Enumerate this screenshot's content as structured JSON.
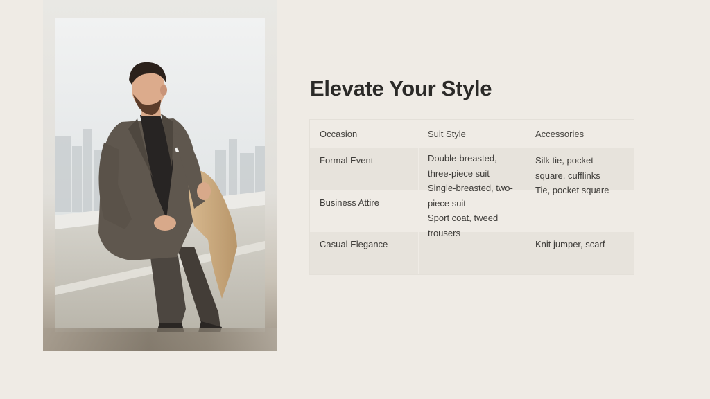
{
  "slide": {
    "title": "Elevate Your Style"
  },
  "photo": {
    "description_icon": "photo-man-in-tweed-suit"
  },
  "table": {
    "headers": [
      "Occasion",
      "Suit Style",
      "Accessories"
    ],
    "rows": [
      {
        "occasion": "Formal Event",
        "suit_line1": "Double-breasted,",
        "suit_line2": "three-piece suit",
        "acc_line1": "Silk tie, pocket",
        "acc_line2": "square, cufflinks"
      },
      {
        "occasion": "Business Attire",
        "suit_line1": "Single-breasted, two-",
        "suit_line2": "piece suit",
        "acc_line1": "Tie, pocket square",
        "acc_line2": ""
      },
      {
        "occasion": "Casual Elegance",
        "suit_line1": "Sport coat, tweed",
        "suit_line2": "trousers",
        "acc_line1": "Knit jumper, scarf",
        "acc_line2": ""
      }
    ]
  },
  "colors": {
    "background": "#efebe5",
    "title": "#2b2a28",
    "row_shade": "#e7e3dc"
  }
}
